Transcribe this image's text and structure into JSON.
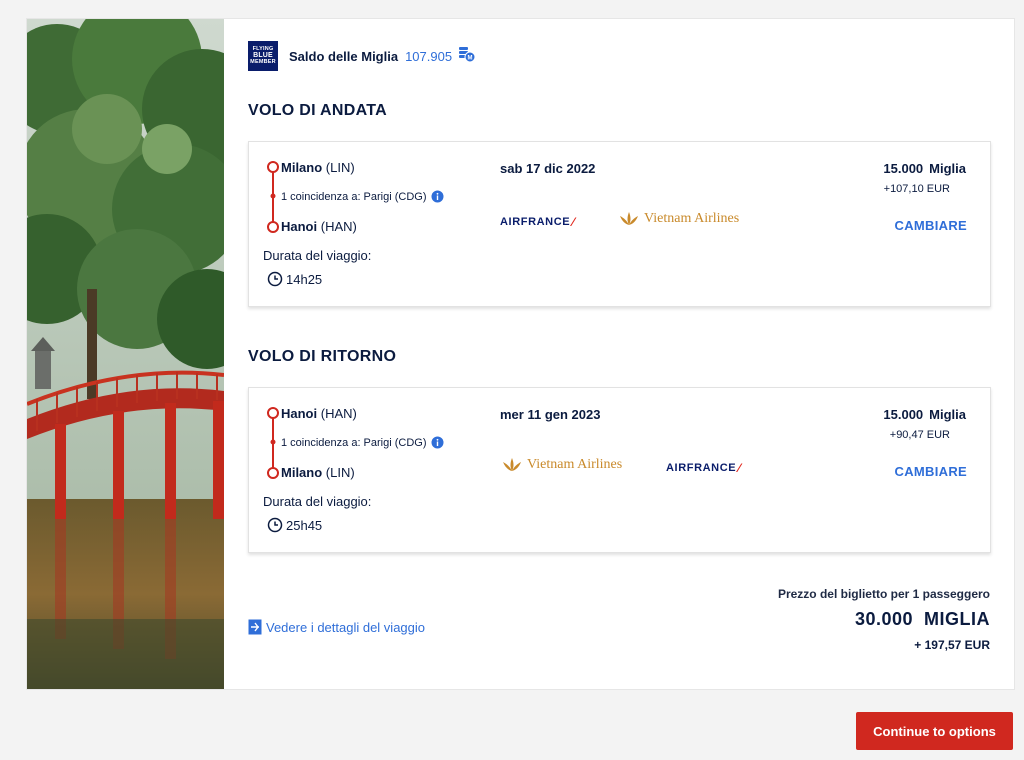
{
  "balance": {
    "logo_lines": [
      "FLYING",
      "BLUE",
      "MEMBER"
    ],
    "label": "Saldo delle Miglia",
    "value": "107.905",
    "icon": "miles-coin-icon"
  },
  "outbound": {
    "title": "VOLO DI ANDATA",
    "origin_city": "Milano",
    "origin_code": "(LIN)",
    "connection": "1 coincidenza a: Parigi (CDG)",
    "destination_city": "Hanoi",
    "destination_code": "(HAN)",
    "duration_label": "Durata del viaggio:",
    "duration": "14h25",
    "date": "sab 17 dic 2022",
    "miles": "15.000",
    "miles_word": "Miglia",
    "eur": "+107,10 EUR",
    "change_label": "CAMBIARE",
    "airlines": [
      "AIRFRANCE",
      "Vietnam Airlines"
    ]
  },
  "return": {
    "title": "VOLO DI RITORNO",
    "origin_city": "Hanoi",
    "origin_code": "(HAN)",
    "connection": "1 coincidenza a: Parigi (CDG)",
    "destination_city": "Milano",
    "destination_code": "(LIN)",
    "duration_label": "Durata del viaggio:",
    "duration": "25h45",
    "date": "mer 11 gen 2023",
    "miles": "15.000",
    "miles_word": "Miglia",
    "eur": "+90,47 EUR",
    "change_label": "CAMBIARE",
    "airlines": [
      "Vietnam Airlines",
      "AIRFRANCE"
    ]
  },
  "details_link": "Vedere i dettagli del viaggio",
  "price": {
    "label": "Prezzo del biglietto per 1 passeggero",
    "miles": "30.000  MIGLIA",
    "eur": "+ 197,57 EUR"
  },
  "continue_label": "Continue to options",
  "colors": {
    "accent_blue": "#2f6ed8",
    "brand_navy": "#0a1d6b",
    "route_red": "#d0281f",
    "cta_red": "#d0281f"
  }
}
